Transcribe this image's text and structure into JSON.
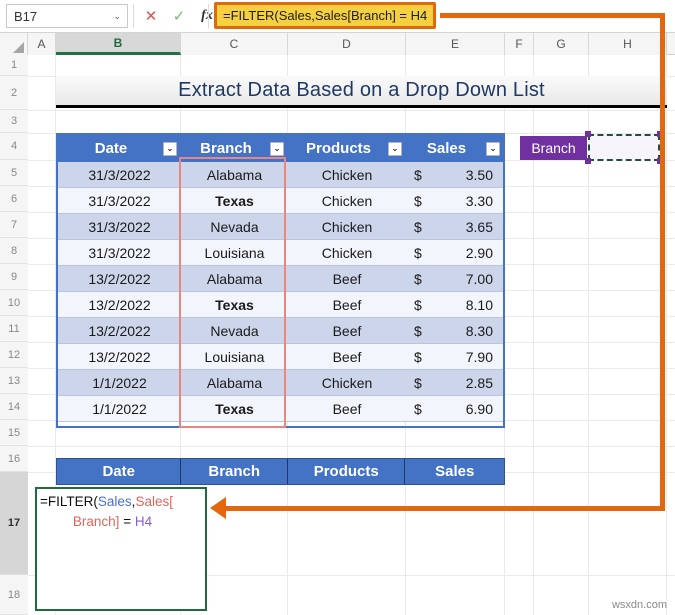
{
  "app": {
    "watermark": "wsxdn.com"
  },
  "formula_bar": {
    "name_box_value": "B17",
    "name_box_caret": "⌄",
    "cancel_icon": "✕",
    "enter_icon": "✓",
    "fx_icon": "fx",
    "formula": "=FILTER(Sales,Sales[Branch] = H4"
  },
  "grid": {
    "columns": [
      "A",
      "B",
      "C",
      "D",
      "E",
      "F",
      "G",
      "H"
    ],
    "selected_column": "B",
    "rows": [
      "1",
      "2",
      "3",
      "4",
      "5",
      "6",
      "7",
      "8",
      "9",
      "10",
      "11",
      "12",
      "13",
      "14",
      "15",
      "16",
      "17",
      "18"
    ],
    "selected_row": "17"
  },
  "title": {
    "text": "Extract Data Based on a Drop Down List"
  },
  "data_table": {
    "headers": [
      "Date",
      "Branch",
      "Products",
      "Sales"
    ],
    "filter_icon": "⌄",
    "currency_symbol": "$",
    "rows": [
      {
        "date": "31/3/2022",
        "branch": "Alabama",
        "product": "Chicken",
        "cur": "$",
        "sales": "3.50"
      },
      {
        "date": "31/3/2022",
        "branch": "Texas",
        "product": "Chicken",
        "cur": "$",
        "sales": "3.30"
      },
      {
        "date": "31/3/2022",
        "branch": "Nevada",
        "product": "Chicken",
        "cur": "$",
        "sales": "3.65"
      },
      {
        "date": "31/3/2022",
        "branch": "Louisiana",
        "product": "Chicken",
        "cur": "$",
        "sales": "2.90"
      },
      {
        "date": "13/2/2022",
        "branch": "Alabama",
        "product": "Beef",
        "cur": "$",
        "sales": "7.00"
      },
      {
        "date": "13/2/2022",
        "branch": "Texas",
        "product": "Beef",
        "cur": "$",
        "sales": "8.10"
      },
      {
        "date": "13/2/2022",
        "branch": "Nevada",
        "product": "Beef",
        "cur": "$",
        "sales": "8.30"
      },
      {
        "date": "13/2/2022",
        "branch": "Louisiana",
        "product": "Beef",
        "cur": "$",
        "sales": "7.90"
      },
      {
        "date": "1/1/2022",
        "branch": "Alabama",
        "product": "Chicken",
        "cur": "$",
        "sales": "2.85"
      },
      {
        "date": "1/1/2022",
        "branch": "Texas",
        "product": "Beef",
        "cur": "$",
        "sales": "6.90"
      }
    ]
  },
  "criteria": {
    "label": "Branch",
    "dropdown_value": ""
  },
  "result_table": {
    "headers": [
      "Date",
      "Branch",
      "Products",
      "Sales"
    ]
  },
  "active_cell": {
    "line1_part1": "=FILTER(",
    "line1_part2": "Sales",
    "line1_part3": ",",
    "line1_part4": "Sales[",
    "line2_part1": "Branch]",
    "line2_part2": "=",
    "line2_part3": "H4"
  },
  "colors": {
    "header_blue": "#4472c4",
    "band_dark": "#ccd5ea",
    "band_light": "#f2f5fb",
    "title_text": "#1f3864",
    "callout_orange": "#e2670d",
    "formula_highlight": "#f5d142",
    "purple": "#7030a0",
    "branch_outline": "#e8867f",
    "active_cell_green": "#1f6b3b"
  }
}
